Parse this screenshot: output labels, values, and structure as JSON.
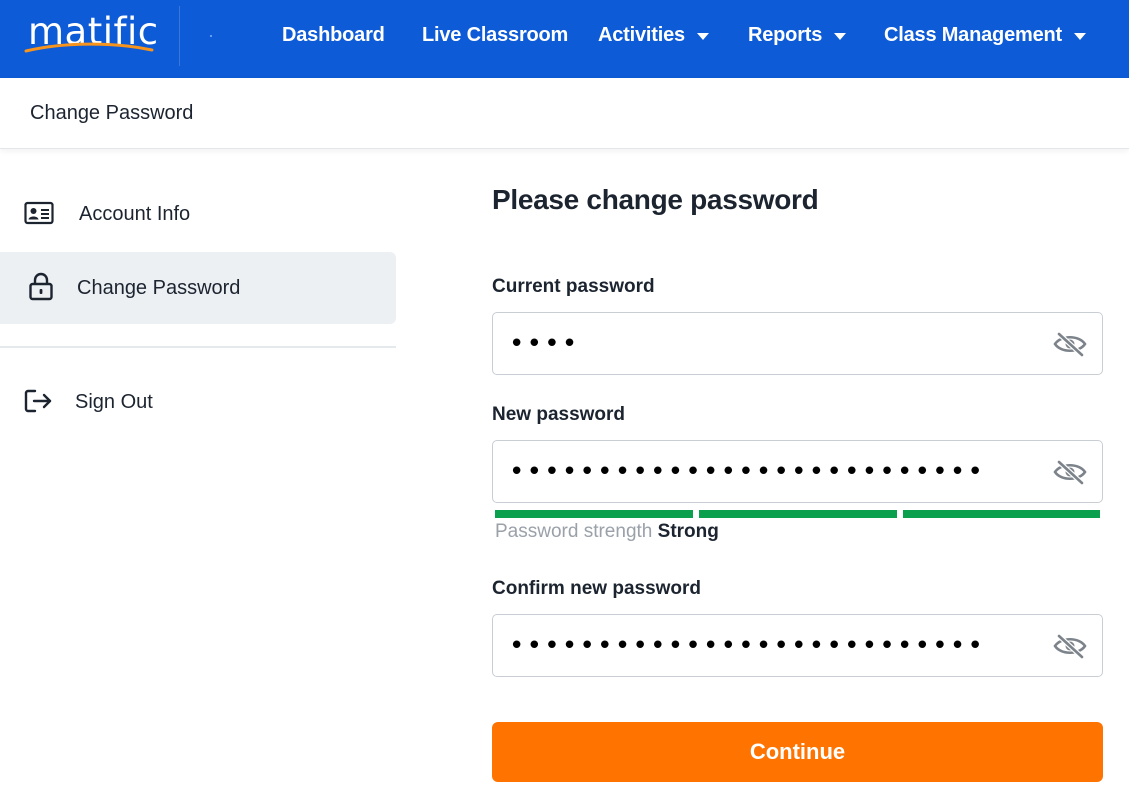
{
  "brand": {
    "logo_text": "matific",
    "nav_color": "#0d5bd6",
    "accent": "#ff7300",
    "strength_color": "#0aa04e"
  },
  "nav": {
    "items": [
      {
        "label": "Dashboard"
      },
      {
        "label": "Live Classroom"
      },
      {
        "label": "Activities"
      },
      {
        "label": "Reports"
      },
      {
        "label": "Class Management"
      }
    ]
  },
  "breadcrumb": {
    "title": "Change Password"
  },
  "sidebar": {
    "items": [
      {
        "label": "Account Info",
        "icon": "id-card-icon"
      },
      {
        "label": "Change Password",
        "icon": "lock-icon",
        "active": true
      },
      {
        "label": "Sign Out",
        "icon": "sign-out-icon"
      }
    ]
  },
  "form": {
    "title": "Please change password",
    "current": {
      "label": "Current password",
      "value": "••••"
    },
    "new": {
      "label": "New password",
      "value": "•••••••••••••••••••••••••••"
    },
    "strength": {
      "prefix": "Password strength",
      "value": "Strong",
      "level": 3,
      "max": 3
    },
    "confirm": {
      "label": "Confirm new password",
      "value": "•••••••••••••••••••••••••••"
    },
    "continue_label": "Continue"
  }
}
